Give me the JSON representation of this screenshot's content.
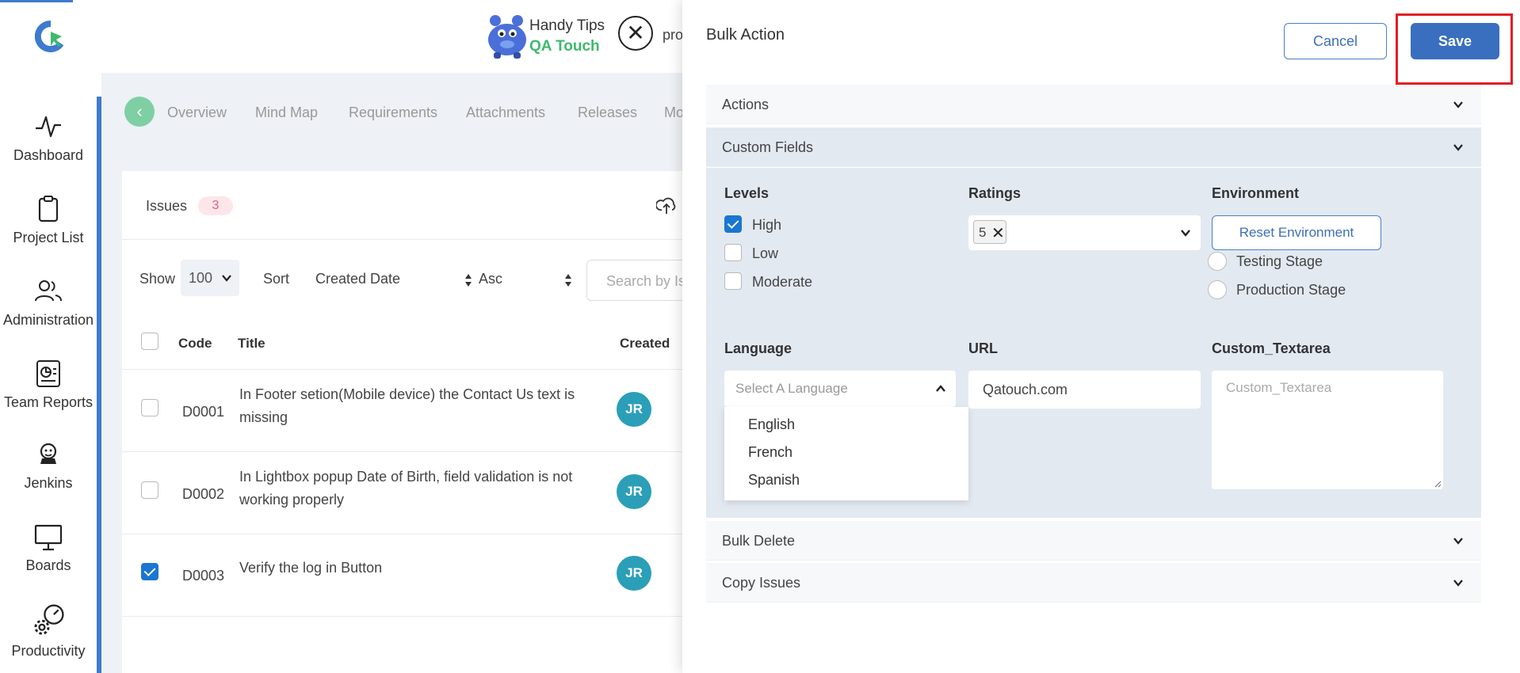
{
  "nav": {
    "items": [
      {
        "label": "Dashboard",
        "icon": "activity-icon"
      },
      {
        "label": "Project List",
        "icon": "clipboard-icon"
      },
      {
        "label": "Administration",
        "icon": "users-icon"
      },
      {
        "label": "Team Reports",
        "icon": "report-icon"
      },
      {
        "label": "Jenkins",
        "icon": "jenkins-icon"
      },
      {
        "label": "Boards",
        "icon": "board-icon"
      },
      {
        "label": "Productivity",
        "icon": "productivity-icon"
      }
    ]
  },
  "header": {
    "handy_title": "Handy Tips",
    "handy_brand": "QA Touch",
    "project_text": "pro"
  },
  "tabs": [
    "Overview",
    "Mind Map",
    "Requirements",
    "Attachments",
    "Releases",
    "Mo"
  ],
  "issues": {
    "label": "Issues",
    "count": "3",
    "show_label": "Show",
    "show_value": "100",
    "sort_label": "Sort",
    "sort_field": "Created Date",
    "sort_order": "Asc",
    "search_placeholder": "Search by Is",
    "columns": {
      "code": "Code",
      "title": "Title",
      "created": "Created"
    },
    "rows": [
      {
        "code": "D0001",
        "title": "In Footer setion(Mobile device) the Contact Us text is missing",
        "avatar": "JR",
        "checked": false
      },
      {
        "code": "D0002",
        "title": "In Lightbox popup Date of Birth, field validation is not working properly",
        "avatar": "JR",
        "checked": false
      },
      {
        "code": "D0003",
        "title": "Verify the log in Button",
        "avatar": "JR",
        "checked": true
      }
    ]
  },
  "drawer": {
    "title": "Bulk Action",
    "cancel_label": "Cancel",
    "save_label": "Save",
    "sections": {
      "actions": "Actions",
      "custom_fields": "Custom Fields",
      "bulk_delete": "Bulk Delete",
      "copy_issues": "Copy Issues"
    },
    "custom_fields": {
      "levels_label": "Levels",
      "levels": [
        {
          "label": "High",
          "checked": true
        },
        {
          "label": "Low",
          "checked": false
        },
        {
          "label": "Moderate",
          "checked": false
        }
      ],
      "ratings_label": "Ratings",
      "ratings_value": "5",
      "environment_label": "Environment",
      "reset_environment_label": "Reset Environment",
      "environment_options": [
        "Testing Stage",
        "Production Stage"
      ],
      "language_label": "Language",
      "language_placeholder": "Select A Language",
      "language_options": [
        "English",
        "French",
        "Spanish"
      ],
      "url_label": "URL",
      "url_value": "Qatouch.com",
      "textarea_label": "Custom_Textarea",
      "textarea_placeholder": "Custom_Textarea"
    }
  },
  "colors": {
    "accent": "#3a6fbf",
    "highlight": "#e11d23",
    "avatar": "#2a9fb7",
    "success": "#3fb96b"
  }
}
